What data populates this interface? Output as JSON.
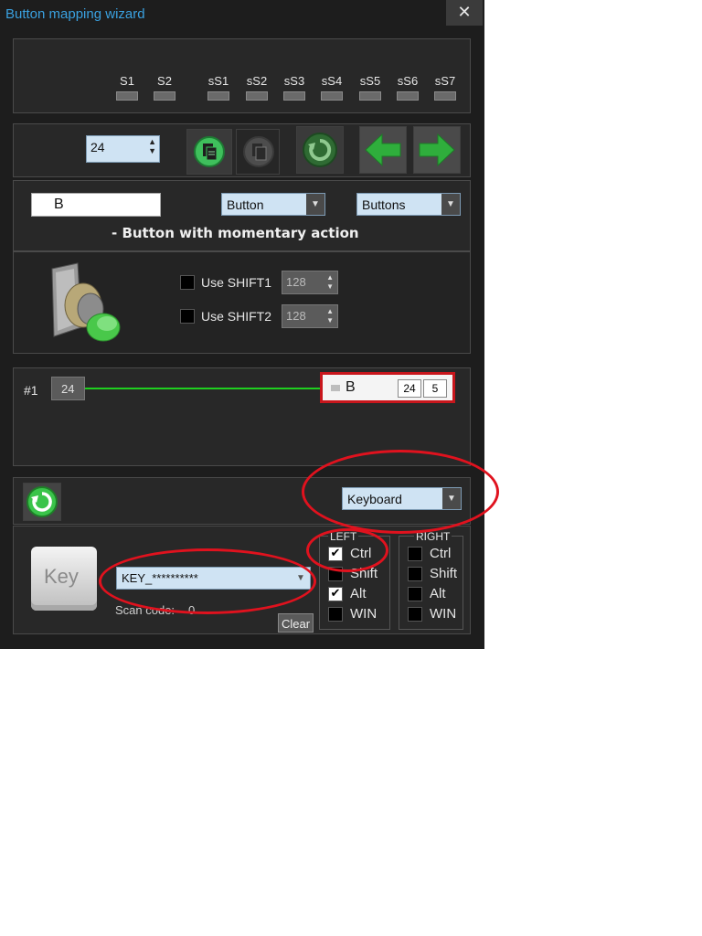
{
  "window": {
    "title": "Button mapping wizard",
    "close_glyph": "✕"
  },
  "switches": [
    "S1",
    "S2",
    "sS1",
    "sS2",
    "sS3",
    "sS4",
    "sS5",
    "sS6",
    "sS7"
  ],
  "toolbar": {
    "index_value": "24"
  },
  "button_def": {
    "name": "B",
    "type": "Button",
    "group": "Buttons",
    "description": "- Button with momentary action",
    "shift1_label": "Use SHIFT1",
    "shift1_value": "128",
    "shift2_label": "Use SHIFT2",
    "shift2_value": "128"
  },
  "mapping": {
    "row_label": "#1",
    "input_value": "24",
    "target_name": "B",
    "target_num1": "24",
    "target_num2": "5"
  },
  "output": {
    "type": "Keyboard",
    "key_label": "Key",
    "key_value": "KEY_**********",
    "scan_code_label": "Scan code:",
    "scan_code_value": "0",
    "clear_label": "Clear"
  },
  "modifiers": {
    "left_title": "LEFT",
    "right_title": "RIGHT",
    "left": [
      {
        "label": "Ctrl",
        "checked": true
      },
      {
        "label": "Shift",
        "checked": false
      },
      {
        "label": "Alt",
        "checked": true
      },
      {
        "label": "WIN",
        "checked": false
      }
    ],
    "right": [
      {
        "label": "Ctrl",
        "checked": false
      },
      {
        "label": "Shift",
        "checked": false
      },
      {
        "label": "Alt",
        "checked": false
      },
      {
        "label": "WIN",
        "checked": false
      }
    ],
    "check_glyph": "✔"
  },
  "colors": {
    "accent": "#3aa1e0",
    "highlight": "#e0121e",
    "signal": "#1fcf1f",
    "field": "#cfe3f3"
  },
  "icons": [
    "close-icon",
    "copy-icon",
    "paste-icon",
    "reset-icon",
    "arrow-left-icon",
    "arrow-right-icon",
    "pushbutton-icon",
    "keycap-icon"
  ]
}
